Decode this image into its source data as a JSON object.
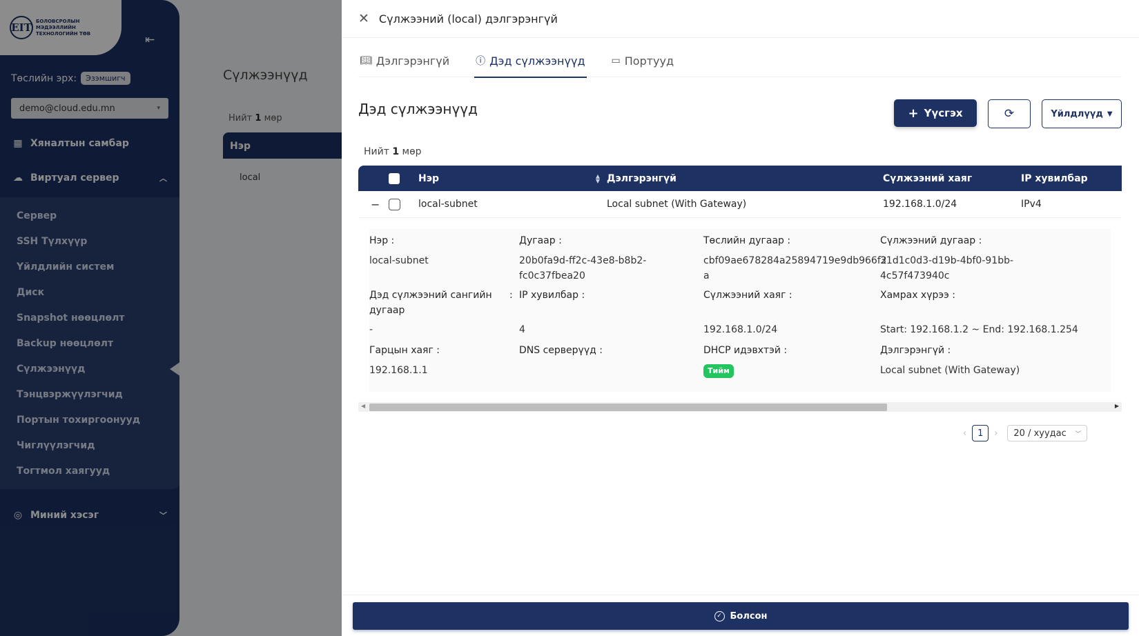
{
  "sidebar": {
    "logo_mark": "EIT",
    "logo_text": "БОЛОВСРОЛЫН МЭДЭЭЛЛИЙН ТЕХНОЛОГИЙН ТӨВ",
    "role_label": "Төслийн эрх:",
    "role_value": "Эзэмшигч",
    "account": "demo@cloud.edu.mn",
    "dashboard": "Хяналтын самбар",
    "virtual_server": "Виртуал сервер",
    "items": [
      {
        "label": "Сервер"
      },
      {
        "label": "SSH Түлхүүр"
      },
      {
        "label": "Үйлдлийн систем"
      },
      {
        "label": "Диск"
      },
      {
        "label": "Snapshot нөөцлөлт"
      },
      {
        "label": "Backup нөөцлөлт"
      },
      {
        "label": "Сүлжээнүүд"
      },
      {
        "label": "Тэнцвэржүүлэгчид"
      },
      {
        "label": "Портын тохиргоонууд"
      },
      {
        "label": "Чиглүүлэгчид"
      },
      {
        "label": "Тогтмол хаягууд"
      }
    ],
    "mine": "Миний хэсэг"
  },
  "background": {
    "title": "Сүлжээнүүд",
    "total_prefix": "Нийт",
    "total_count": "1",
    "total_suffix": "мөр",
    "col_name": "Нэр",
    "row_name": "local"
  },
  "drawer": {
    "title": "Сүлжээний (local) дэлгэрэнгүй",
    "tabs": [
      {
        "label": "Дэлгэрэнгүй",
        "icon": "book-icon"
      },
      {
        "label": "Дэд сүлжээнүүд",
        "icon": "info-icon"
      },
      {
        "label": "Портууд",
        "icon": "port-icon"
      }
    ],
    "section_title": "Дэд сүлжээнүүд",
    "create_label": "Үүсгэх",
    "actions_label": "Үйлдлүүд",
    "total_prefix": "Нийт",
    "total_count": "1",
    "total_suffix": "мөр",
    "table": {
      "headers": [
        "Нэр",
        "Дэлгэрэнгүй",
        "Сүлжээний хаяг",
        "IP хувилбар"
      ],
      "row": {
        "name": "local-subnet",
        "description": "Local subnet (With Gateway)",
        "cidr": "192.168.1.0/24",
        "ip_version": "IPv4"
      }
    },
    "detail": {
      "name_label": "Нэр",
      "name_value": "local-subnet",
      "id_label": "Дугаар",
      "id_value_1": "20b0fa9d-ff2c-43e8-b8b2-",
      "id_value_2": "fc0c37fbea20",
      "project_label": "Төслийн дугаар",
      "project_value_1": "cbf09ae678284a25894719e9db966f2",
      "project_value_2": "a",
      "network_id_label": "Сүлжээний дугаар",
      "network_id_value_1": "31d1c0d3-d19b-4bf0-91bb-",
      "network_id_value_2": "4c57f473940c",
      "pool_label_1": "Дэд сүлжээний сангийн",
      "pool_label_2": "дугаар",
      "pool_value": "-",
      "ipver_label": "IP хувилбар",
      "ipver_value": "4",
      "cidr_label": "Сүлжээний хаяг",
      "cidr_value": "192.168.1.0/24",
      "range_label": "Хамрах хүрээ",
      "range_value": "Start: 192.168.1.2 ~ End: 192.168.1.254",
      "gateway_label": "Гарцын хаяг",
      "gateway_value": "192.168.1.1",
      "dns_label": "DNS серверүүд",
      "dhcp_label": "DHCP идэвхтэй",
      "dhcp_value": "Тийм",
      "desc_label": "Дэлгэрэнгүй",
      "desc_value": "Local subnet (With Gateway)"
    },
    "pagination": {
      "current": "1",
      "page_size": "20 / хуудас"
    },
    "done_label": "Болсон"
  },
  "colors": {
    "primary": "#1d3163",
    "success": "#22c55e"
  }
}
